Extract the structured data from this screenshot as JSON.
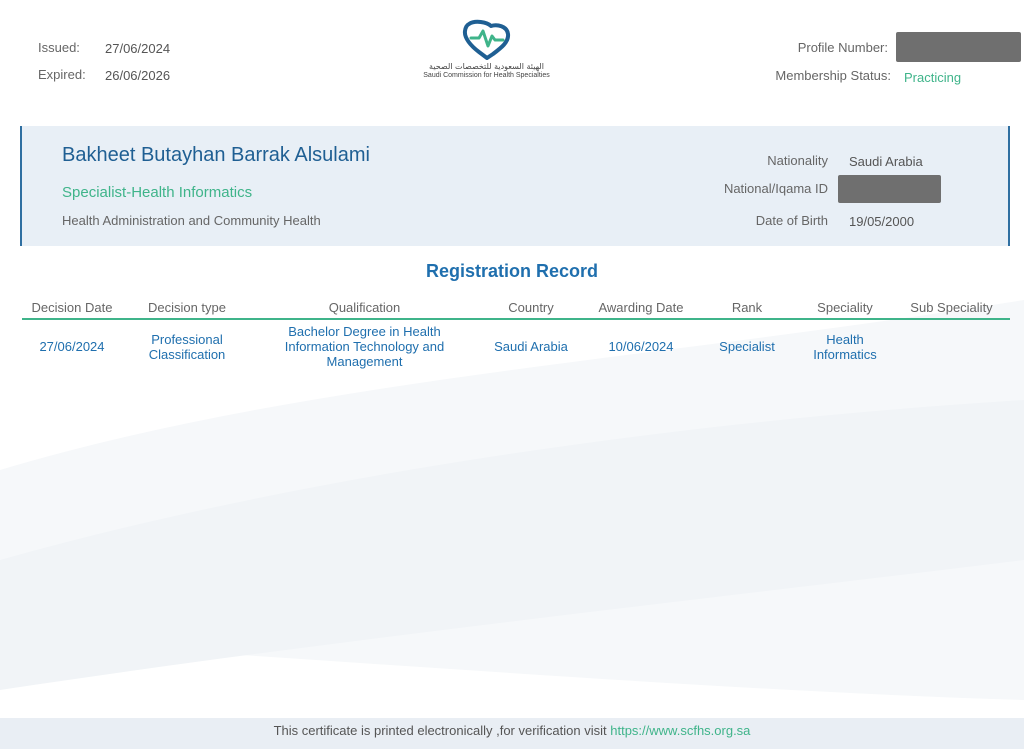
{
  "header": {
    "issued_label": "Issued:",
    "issued_value": "27/06/2024",
    "expired_label": "Expired:",
    "expired_value": "26/06/2026",
    "logo_arabic": "الهيئة السعودية للتخصصات الصحية",
    "logo_english": "Saudi Commission for Health Specialties",
    "profile_label": "Profile Number:",
    "status_label": "Membership Status:",
    "status_value": "Practicing"
  },
  "person": {
    "name": "Bakheet Butayhan Barrak Alsulami",
    "title": "Specialist-Health Informatics",
    "department": "Health Administration and Community Health",
    "nationality_label": "Nationality",
    "nationality_value": "Saudi Arabia",
    "national_id_label": "National/Iqama ID",
    "dob_label": "Date of Birth",
    "dob_value": "19/05/2000"
  },
  "registration": {
    "title": "Registration Record",
    "columns": [
      "Decision Date",
      "Decision type",
      "Qualification",
      "Country",
      "Awarding Date",
      "Rank",
      "Speciality",
      "Sub Speciality"
    ],
    "rows": [
      {
        "decision_date": "27/06/2024",
        "decision_type": "Professional Classification",
        "qualification": "Bachelor Degree in Health Information Technology and Management",
        "country": "Saudi Arabia",
        "awarding_date": "10/06/2024",
        "rank": "Specialist",
        "speciality": "Health Informatics",
        "sub_speciality": ""
      }
    ]
  },
  "footer": {
    "text": "This certificate is printed electronically ,for verification visit",
    "link": "https://www.scfhs.org.sa"
  },
  "colors": {
    "brand_blue": "#1f6fae",
    "brand_green": "#3fb48a",
    "panel_bg": "#e8eff6"
  }
}
